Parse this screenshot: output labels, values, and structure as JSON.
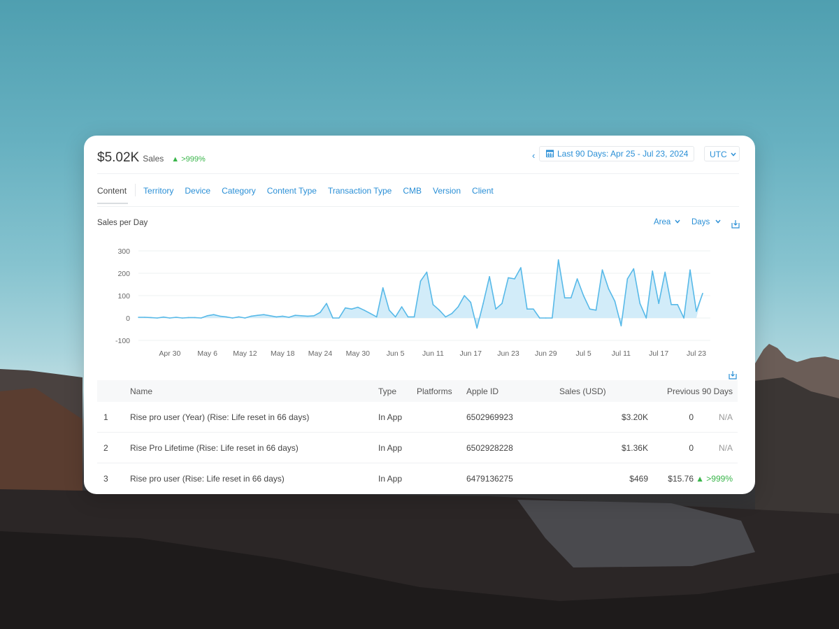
{
  "header": {
    "total": "$5.02K",
    "metric_label": "Sales",
    "change": "▲ >999%"
  },
  "date_range": {
    "prev_icon": "chevron-left-icon",
    "calendar_icon": "calendar-icon",
    "label": "Last 90 Days: Apr 25 - Jul 23, 2024"
  },
  "timezone": {
    "label": "UTC ",
    "icon": "chevron-down-icon"
  },
  "tabs": [
    {
      "label": "Content",
      "active": true
    },
    {
      "label": "Territory"
    },
    {
      "label": "Device"
    },
    {
      "label": "Category"
    },
    {
      "label": "Content Type"
    },
    {
      "label": "Transaction Type"
    },
    {
      "label": "CMB"
    },
    {
      "label": "Version"
    },
    {
      "label": "Client"
    }
  ],
  "chart_controls": {
    "title": "Sales per Day",
    "chart_type": "Area",
    "interval": "Days",
    "download_icon": "download-icon"
  },
  "colors": {
    "accent": "#2a8fd6",
    "series_line": "#57b9e8",
    "series_fill": "#d2ecf9",
    "positive": "#39b54a"
  },
  "chart_data": {
    "type": "area",
    "title": "Sales per Day",
    "ylim": [
      -100,
      300
    ],
    "yticks": [
      300,
      200,
      100,
      0,
      -100
    ],
    "xtick_labels": [
      "Apr 30",
      "May 6",
      "May 12",
      "May 18",
      "May 24",
      "May 30",
      "Jun 5",
      "Jun 11",
      "Jun 17",
      "Jun 23",
      "Jun 29",
      "Jul 5",
      "Jul 11",
      "Jul 17",
      "Jul 23"
    ],
    "x": [
      "Apr 25",
      "Apr 26",
      "Apr 27",
      "Apr 28",
      "Apr 29",
      "Apr 30",
      "May 1",
      "May 2",
      "May 3",
      "May 4",
      "May 5",
      "May 6",
      "May 7",
      "May 8",
      "May 9",
      "May 10",
      "May 11",
      "May 12",
      "May 13",
      "May 14",
      "May 15",
      "May 16",
      "May 17",
      "May 18",
      "May 19",
      "May 20",
      "May 21",
      "May 22",
      "May 23",
      "May 24",
      "May 25",
      "May 26",
      "May 27",
      "May 28",
      "May 29",
      "May 30",
      "May 31",
      "Jun 1",
      "Jun 2",
      "Jun 3",
      "Jun 4",
      "Jun 5",
      "Jun 6",
      "Jun 7",
      "Jun 8",
      "Jun 9",
      "Jun 10",
      "Jun 11",
      "Jun 12",
      "Jun 13",
      "Jun 14",
      "Jun 15",
      "Jun 16",
      "Jun 17",
      "Jun 18",
      "Jun 19",
      "Jun 20",
      "Jun 21",
      "Jun 22",
      "Jun 23",
      "Jun 24",
      "Jun 25",
      "Jun 26",
      "Jun 27",
      "Jun 28",
      "Jun 29",
      "Jun 30",
      "Jul 1",
      "Jul 2",
      "Jul 3",
      "Jul 4",
      "Jul 5",
      "Jul 6",
      "Jul 7",
      "Jul 8",
      "Jul 9",
      "Jul 10",
      "Jul 11",
      "Jul 12",
      "Jul 13",
      "Jul 14",
      "Jul 15",
      "Jul 16",
      "Jul 17",
      "Jul 18",
      "Jul 19",
      "Jul 20",
      "Jul 21",
      "Jul 22",
      "Jul 23"
    ],
    "series": [
      {
        "values": [
          3,
          3,
          2,
          0,
          4,
          0,
          3,
          0,
          2,
          2,
          0,
          10,
          15,
          8,
          5,
          0,
          5,
          0,
          8,
          12,
          15,
          10,
          5,
          8,
          3,
          12,
          10,
          8,
          10,
          25,
          65,
          0,
          0,
          45,
          40,
          48,
          35,
          20,
          5,
          135,
          35,
          5,
          50,
          5,
          5,
          165,
          205,
          60,
          35,
          5,
          20,
          50,
          100,
          70,
          -45,
          65,
          185,
          40,
          65,
          180,
          175,
          225,
          40,
          40,
          0,
          0,
          0,
          260,
          90,
          90,
          175,
          100,
          40,
          35,
          215,
          130,
          75,
          -35,
          175,
          220,
          65,
          0,
          210,
          65,
          205,
          60,
          60,
          0,
          215,
          30,
          110
        ]
      }
    ]
  },
  "table": {
    "download_icon": "download-icon",
    "headers": {
      "name": "Name",
      "type": "Type",
      "platforms": "Platforms",
      "apple_id": "Apple ID",
      "sales": "Sales (USD)",
      "previous": "Previous 90 Days"
    },
    "rows": [
      {
        "rank": "1",
        "name": "Rise pro user (Year) (Rise: Life reset in 66 days)",
        "type": "In App",
        "platforms": "",
        "apple_id": "6502969923",
        "sales": "$3.20K",
        "previous": "0",
        "change": "N/A"
      },
      {
        "rank": "2",
        "name": "Rise Pro Lifetime (Rise: Life reset in 66 days)",
        "type": "In App",
        "platforms": "",
        "apple_id": "6502928228",
        "sales": "$1.36K",
        "previous": "0",
        "change": "N/A"
      },
      {
        "rank": "3",
        "name": "Rise pro user (Rise: Life reset in 66 days)",
        "type": "In App",
        "platforms": "",
        "apple_id": "6479136275",
        "sales": "$469",
        "previous": "$15.76",
        "change": "▲ >999%"
      }
    ]
  }
}
